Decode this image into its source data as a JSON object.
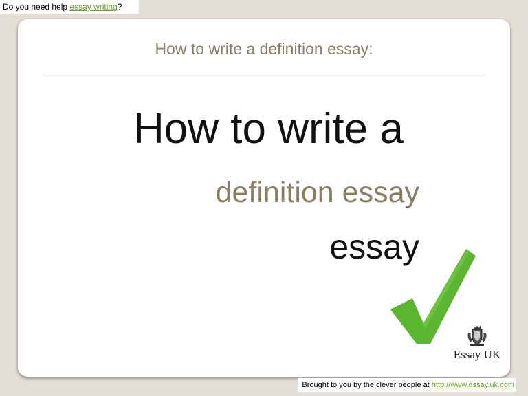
{
  "header": {
    "prefix": "Do you need help ",
    "link_text": "essay writing",
    "suffix": "?"
  },
  "slide": {
    "title": "How to write a definition essay:",
    "line1": "How to write a",
    "line2": "definition essay",
    "line3": "essay",
    "logo_text": "Essay UK"
  },
  "footer": {
    "prefix": "Brought to you by the clever people at ",
    "link_text": "http://www.essay.uk.com"
  },
  "icons": [
    "checkmark-icon",
    "crest-icon"
  ],
  "colors": {
    "background": "#e3ded5",
    "title": "#8a7e6b",
    "accent_text": "#8a7e62",
    "check": "#5ab52f",
    "link": "#6aa121"
  }
}
